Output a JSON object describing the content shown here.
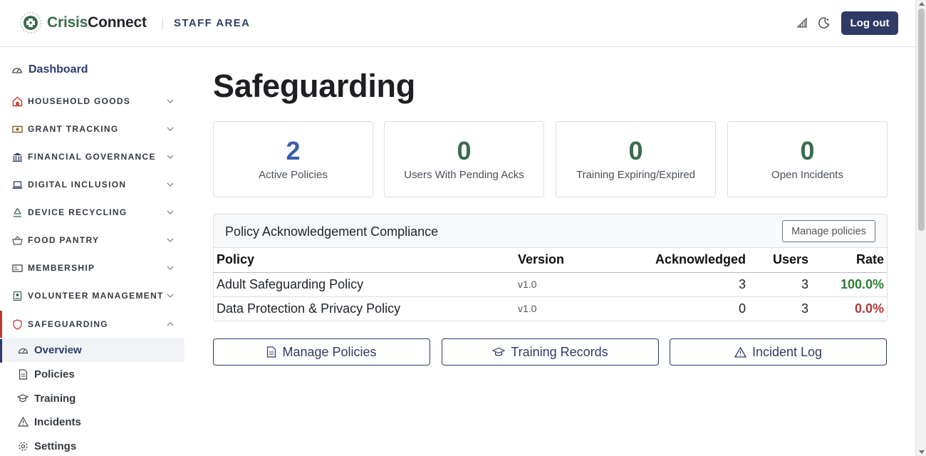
{
  "header": {
    "brand_part1": "Crisis",
    "brand_part2": "Connect",
    "area_label": "STAFF AREA",
    "logout_label": "Log out",
    "icons": [
      "accessibility-icon",
      "dark-mode-icon"
    ]
  },
  "sidebar": {
    "dashboard_label": "Dashboard",
    "sections": [
      {
        "label": "HOUSEHOLD GOODS",
        "icon": "house-icon"
      },
      {
        "label": "GRANT TRACKING",
        "icon": "money-icon"
      },
      {
        "label": "FINANCIAL GOVERNANCE",
        "icon": "bank-icon"
      },
      {
        "label": "DIGITAL INCLUSION",
        "icon": "laptop-icon"
      },
      {
        "label": "DEVICE RECYCLING",
        "icon": "recycle-icon"
      },
      {
        "label": "FOOD PANTRY",
        "icon": "basket-icon"
      },
      {
        "label": "MEMBERSHIP",
        "icon": "id-card-icon"
      },
      {
        "label": "VOLUNTEER MANAGEMENT",
        "icon": "badge-icon"
      },
      {
        "label": "SAFEGUARDING",
        "icon": "shield-icon"
      }
    ],
    "sub_items": [
      {
        "label": "Overview",
        "icon": "gauge-icon"
      },
      {
        "label": "Policies",
        "icon": "document-icon"
      },
      {
        "label": "Training",
        "icon": "graduation-cap-icon"
      },
      {
        "label": "Incidents",
        "icon": "warning-icon"
      },
      {
        "label": "Settings",
        "icon": "gear-icon"
      }
    ]
  },
  "main": {
    "title": "Safeguarding",
    "stats": [
      {
        "value": "2",
        "label": "Active Policies",
        "color": "#3a5dae"
      },
      {
        "value": "0",
        "label": "Users With Pending Acks",
        "color": "#3a6b4c"
      },
      {
        "value": "0",
        "label": "Training Expiring/Expired",
        "color": "#3a6b4c"
      },
      {
        "value": "0",
        "label": "Open Incidents",
        "color": "#3a6b4c"
      }
    ],
    "compliance": {
      "title": "Policy Acknowledgement Compliance",
      "manage_label": "Manage policies",
      "columns": [
        "Policy",
        "Version",
        "Acknowledged",
        "Users",
        "Rate"
      ],
      "rows": [
        {
          "policy": "Adult Safeguarding Policy",
          "version": "v1.0",
          "acknowledged": "3",
          "users": "3",
          "rate": "100.0%"
        },
        {
          "policy": "Data Protection & Privacy Policy",
          "version": "v1.0",
          "acknowledged": "0",
          "users": "3",
          "rate": "0.0%"
        }
      ]
    },
    "actions": [
      {
        "label": "Manage Policies",
        "icon": "document-icon"
      },
      {
        "label": "Training Records",
        "icon": "graduation-cap-icon"
      },
      {
        "label": "Incident Log",
        "icon": "warning-icon"
      }
    ]
  }
}
